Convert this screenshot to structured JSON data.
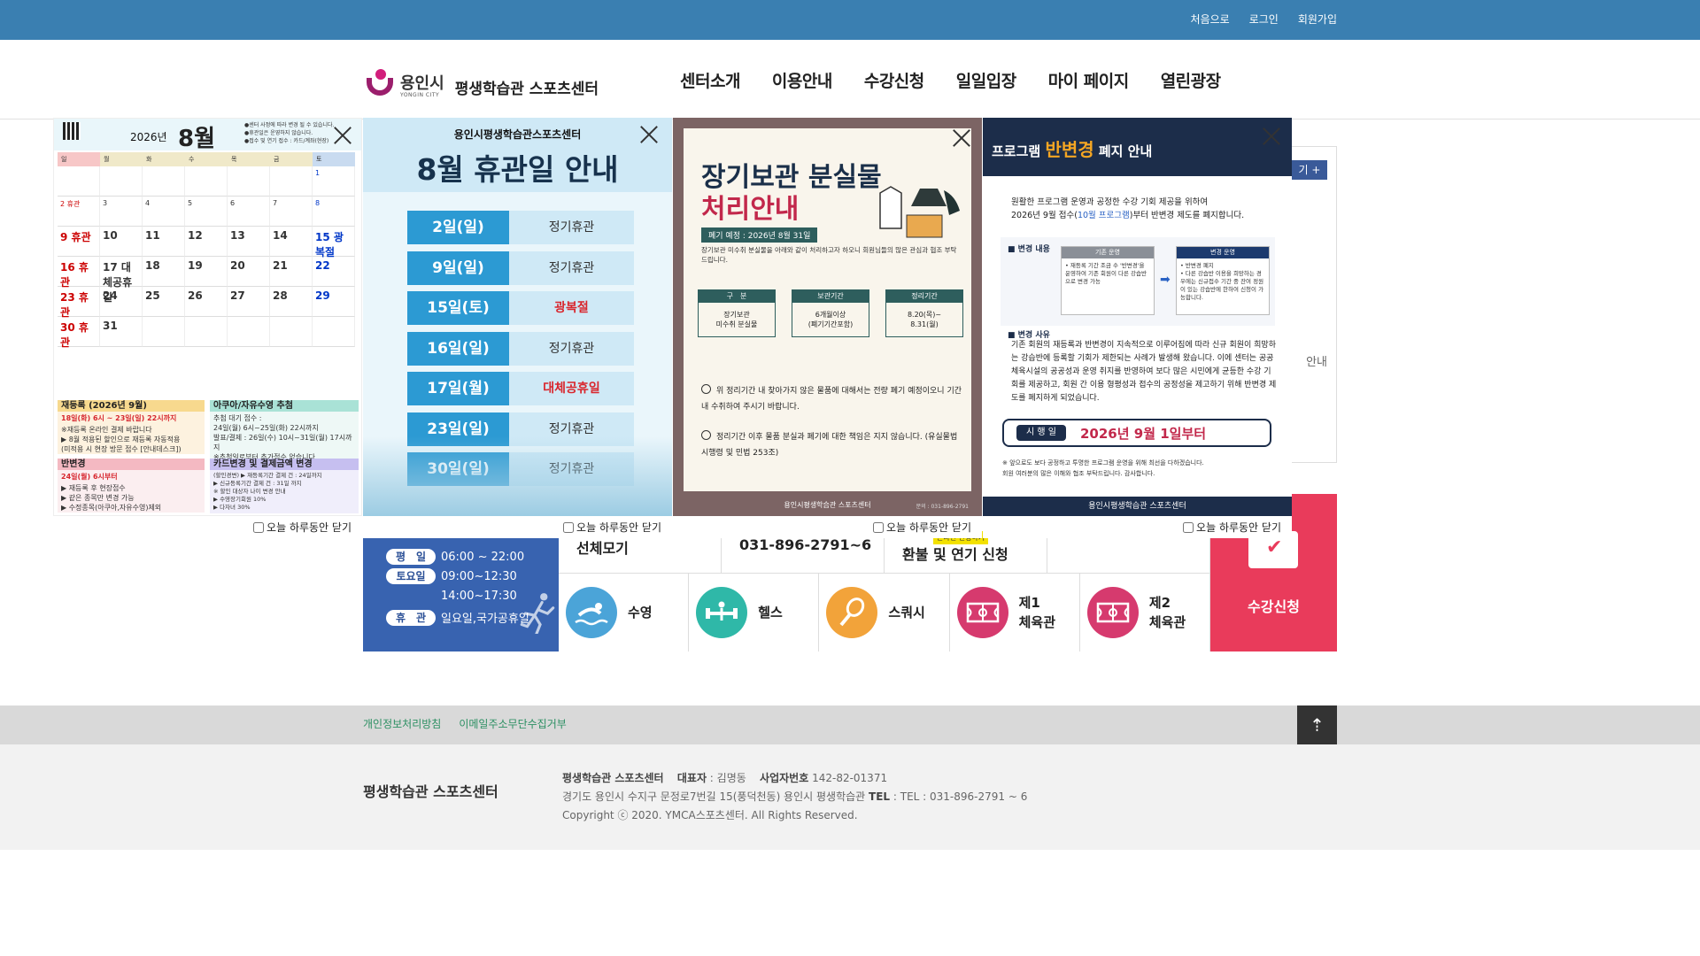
{
  "toplinks": [
    "처음으로",
    "로그인",
    "회원가입"
  ],
  "logo": {
    "city": "용인시",
    "city_en": "YONGIN CITY",
    "name": "평생학습관 스포츠센터"
  },
  "nav": [
    "센터소개",
    "이용안내",
    "수강신청",
    "일일입장",
    "마이 페이지",
    "열린광장"
  ],
  "behind": {
    "button": "기 +",
    "text": "안내"
  },
  "hours": [
    {
      "label": "평　일",
      "value": "06:00 ~ 22:00"
    },
    {
      "label": "토요일",
      "value": "09:00~12:30"
    },
    {
      "label": "",
      "value": "14:00~17:30"
    },
    {
      "label": "휴　관",
      "value": "일요일,국가공휴일"
    }
  ],
  "top_cells": [
    "선체모기",
    "031-896-2791~6",
    "환불 및 연기 신청",
    ""
  ],
  "refund_badge": "온라인 신청하기",
  "facilities": [
    {
      "name": "수영",
      "icon": "swim-icon",
      "color": "#4ba4d8"
    },
    {
      "name": "헬스",
      "icon": "fitness-icon",
      "color": "#2fb8a8"
    },
    {
      "name": "스쿼시",
      "icon": "squash-icon",
      "color": "#f2a33a"
    },
    {
      "name": "제1\n체육관",
      "icon": "court-icon",
      "color": "#d63a6e"
    },
    {
      "name": "제2\n체육관",
      "icon": "court-icon",
      "color": "#d63a6e"
    }
  ],
  "apply_label": "수강신청",
  "footer": {
    "links": [
      "개인정보처리방침",
      "이메일주소무단수집거부"
    ],
    "logo": "평생학습관 스포츠센터",
    "line1_a": "평생학습관 스포츠센터",
    "rep_label": "대표자",
    "rep": "김명동",
    "biz_label": "사업자번호",
    "biz": "142-82-01371",
    "addr": "경기도 용인시 수지구 문정로7번길 15(풍덕천동) 용인시 평생학습관",
    "tel_label": "TEL",
    "tel": "TEL : 031-896-2791 ~ 6",
    "copyright": "Copyright ⓒ 2020. YMCA스포츠센터. All Rights Reserved."
  },
  "close_today": "오늘 하루동안 닫기",
  "popup1": {
    "year": "2026년",
    "month": "8월",
    "note": "●센터 사정에 따라 변경 될 수 있습니다.\n●휴관일은 운영하지 않습니다.\n●접수 및 연기 접수 : 카드/계좌(현장)",
    "dow": [
      "일",
      "월",
      "화",
      "수",
      "목",
      "금",
      "토"
    ],
    "days": [
      "",
      "",
      "",
      "",
      "",
      "",
      "1",
      "2 휴관",
      "3",
      "4",
      "5",
      "6",
      "7",
      "8",
      "9 휴관",
      "10",
      "11",
      "12",
      "13",
      "14",
      "15 광복절",
      "16 휴관",
      "17 대체공휴일",
      "18",
      "19",
      "20",
      "21",
      "22",
      "23 휴관",
      "24",
      "25",
      "26",
      "27",
      "28",
      "29",
      "30 휴관",
      "31",
      "",
      "",
      "",
      "",
      ""
    ],
    "rereg_title": "재등록 (2026년 9월)",
    "rereg_date": "18일(화) 6시 ~ 23일(일) 22시까지",
    "rereg_notes": "※재등록 온라인 결제 바랍니다\n▶ 8월 적용된 할인으로 재등록 자동적용\n(미적용 시 현장 방문 접수 [안내데스크])",
    "swim_title": "아쿠아/자유수영 추첨",
    "swim_text": "추첨 대기 접수 :\n24일(월) 6시~25일(화) 22시까지\n발표/결제 : 26일(수) 10시~31일(월) 17시까지\n※추첨일로부터 추가접수 없습니다.",
    "change_title": "반변경",
    "change_date": "24일(월) 6시부터",
    "change_notes": "▶ 재등록 후 현장접수\n▶ 같은 종목만 변경 가능\n▶ 수정종목(아쿠아,자유수영)제외",
    "card_title": "카드변경 및 결제금액 변경",
    "card_text": "(할인경변) ▶ 재등록기간 결제 건 : 24일까지\n▶ 신규등록기간 결제 건 : 31일 까지\n※ 할인 대상자 나이 변경 안내\n▶ 수영장기회원 10%\n▶ 다자녀 30%"
  },
  "popup2": {
    "sub": "용인시평생학습관스포츠센터",
    "title": "8월 휴관일 안내",
    "rows": [
      {
        "date": "2일(일)",
        "type": "정기휴관",
        "hol": false
      },
      {
        "date": "9일(일)",
        "type": "정기휴관",
        "hol": false
      },
      {
        "date": "15일(토)",
        "type": "광복절",
        "hol": true
      },
      {
        "date": "16일(일)",
        "type": "정기휴관",
        "hol": false
      },
      {
        "date": "17일(월)",
        "type": "대체공휴일",
        "hol": true
      },
      {
        "date": "23일(일)",
        "type": "정기휴관",
        "hol": false
      },
      {
        "date": "30일(일)",
        "type": "정기휴관",
        "hol": false
      }
    ]
  },
  "popup3": {
    "title1": "장기보관 분실물",
    "title2": "처리안내",
    "date": "폐기 예정 : 2026년 8월 31일",
    "desc": "장기보관 미수취 분실물을 아래와 같이 처리하고자 하오니 회원님들의 많은 관심과 협조 부탁 드립니다.",
    "cols": [
      {
        "h": "구　분",
        "v": "장기보관\n미수취 분실물"
      },
      {
        "h": "보관기간",
        "v": "6개월이상\n(폐기기간포함)"
      },
      {
        "h": "정리기간",
        "v": "8.20(목)~\n8.31(월)"
      }
    ],
    "li1": "위 정리기간 내 찾아가지 않은 물품에 대해서는 전량 폐기 예정이오니 기간내 수취하여 주시기 바랍니다.",
    "li2": "정리기간 이후 물품 분실과 폐기에 대한 책임은 지지 않습니다. (유실물법 시행령 및 민법 253조)",
    "foot": "용인시평생학습관 스포츠센터",
    "phone": "문의 : 031-896-2791"
  },
  "popup4": {
    "title_a": "프로그램 ",
    "title_hl": "반변경",
    "title_b": " 폐지 안내",
    "intro1": "원활한 프로그램 운영과 공정한 수강 기회 제공을 위하여",
    "intro2_a": "2026년 9월 접수(",
    "intro2_hl": "10월 프로그램",
    "intro2_b": ")부터 반변경 제도를 폐지합니다.",
    "sec1": "■ 변경 내용",
    "before_h": "기존 운영",
    "before_t": "• 재등록 기간 조금 수 '반변경'을 운영하여 기존 회원이 다른 강습반으로 변경 가능",
    "after_h": "변경 운영",
    "after_t": "• 반변경 폐지\n• 다른 강습반 이용을 희망하는 경우에는 신규접수 기간 중 잔여 정원이 있는 강습반에 한하여 신청이 가능합니다.",
    "sec2": "■ 변경 사유",
    "reason": "기존 회원의 재등록과 반변경이 지속적으로 이루어짐에 따라 신규 회원이 희망하는 강습반에 등록할 기회가 제한되는 사례가 발생해 왔습니다. 이에 센터는 공공체육시설의 공공성과 운영 취지를 반영하여 보다 많은 시민에게 균등한 수강 기회를 제공하고, 회원 간 이용 형평성과 접수의 공정성을 제고하기 위해 반변경 제도를 폐지하게 되었습니다.",
    "date_label": "시 행 일",
    "date_val": "2026년 9월 1일부터",
    "note": "※ 앞으로도 보다 공정하고 투명한 프로그램 운영을 위해 최선을 다하겠습니다.\n회원 여러분의 많은 이해와 협조 부탁드립니다. 감사합니다.",
    "foot": "용인시평생학습관 스포츠센터"
  }
}
